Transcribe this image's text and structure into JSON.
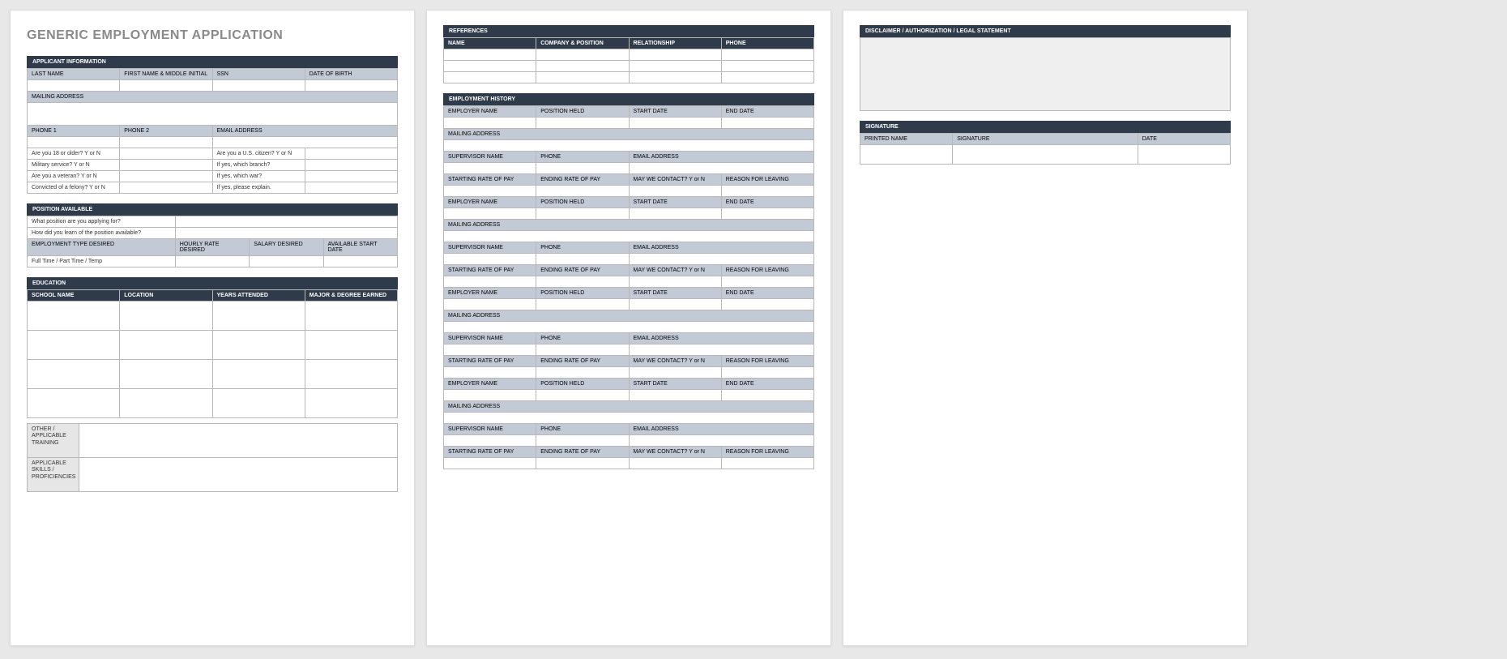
{
  "title": "GENERIC EMPLOYMENT APPLICATION",
  "applicant": {
    "header": "APPLICANT INFORMATION",
    "last_name": "LAST NAME",
    "first_name": "FIRST NAME & MIDDLE INITIAL",
    "ssn": "SSN",
    "dob": "DATE OF BIRTH",
    "mailing": "MAILING ADDRESS",
    "phone1": "PHONE 1",
    "phone2": "PHONE 2",
    "email": "EMAIL ADDRESS",
    "q_age": "Are you 18 or older?  Y or N",
    "q_citizen": "Are you a U.S. citizen?  Y or N",
    "q_military": "Military service?  Y or N",
    "q_branch": "If yes, which branch?",
    "q_veteran": "Are you a veteran?  Y or N",
    "q_war": "If yes, which war?",
    "q_felony": "Convicted of a felony?  Y or N",
    "q_explain": "If yes, please explain."
  },
  "position": {
    "header": "POSITION AVAILABLE",
    "q_position": "What position are you applying for?",
    "q_learn": "How did you learn of the position available?",
    "emp_type": "EMPLOYMENT TYPE DESIRED",
    "hourly": "HOURLY RATE DESIRED",
    "salary": "SALARY DESIRED",
    "start": "AVAILABLE START DATE",
    "ftpt": "Full Time / Part Time / Temp"
  },
  "education": {
    "header": "EDUCATION",
    "school": "SCHOOL NAME",
    "location": "LOCATION",
    "years": "YEARS ATTENDED",
    "major": "MAJOR & DEGREE EARNED",
    "other": "OTHER / APPLICABLE TRAINING",
    "skills": "APPLICABLE SKILLS / PROFICIENCIES"
  },
  "references": {
    "header": "REFERENCES",
    "name": "NAME",
    "company": "COMPANY & POSITION",
    "relationship": "RELATIONSHIP",
    "phone": "PHONE"
  },
  "employment": {
    "header": "EMPLOYMENT HISTORY",
    "employer": "EMPLOYER NAME",
    "position_held": "POSITION HELD",
    "start_date": "START DATE",
    "end_date": "END DATE",
    "mailing": "MAILING ADDRESS",
    "supervisor": "SUPERVISOR NAME",
    "phone": "PHONE",
    "email": "EMAIL ADDRESS",
    "start_pay": "STARTING RATE OF PAY",
    "end_pay": "ENDING RATE OF PAY",
    "contact": "MAY WE CONTACT? Y or N",
    "reason": "REASON FOR LEAVING"
  },
  "disclaimer": {
    "header": "DISCLAIMER / AUTHORIZATION / LEGAL STATEMENT"
  },
  "signature": {
    "header": "SIGNATURE",
    "printed": "PRINTED NAME",
    "signature": "SIGNATURE",
    "date": "DATE"
  }
}
